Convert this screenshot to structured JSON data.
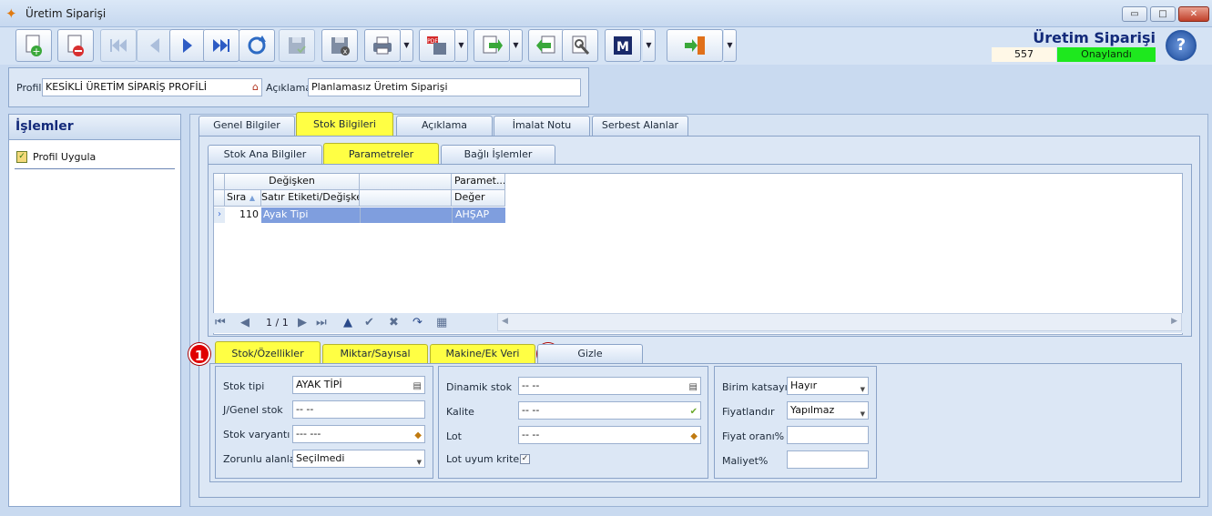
{
  "window": {
    "title": "Üretim Siparişi",
    "controls": {
      "minimize": "▭",
      "maximize": "□",
      "close": "✕"
    }
  },
  "toolbar": {
    "buttons": [
      "new-document-icon",
      "delete-document-icon",
      "first-record-icon",
      "previous-record-icon",
      "next-record-icon",
      "last-record-icon",
      "refresh-icon",
      "save-icon",
      "cancel-save-icon",
      "print-icon",
      "pdf-export-icon",
      "export-icon",
      "import-icon",
      "settings-icon",
      "m-logo-icon",
      "exit-icon"
    ]
  },
  "header": {
    "form_title": "Üretim Siparişi",
    "doc_number": "557",
    "status": "Onaylandı",
    "status_color": "#1ee81e",
    "help": "?"
  },
  "profile": {
    "profil_label": "Profil",
    "profil_value": "KESİKLİ ÜRETİM SİPARİŞ PROFİLİ",
    "aciklama_label": "Açıklama",
    "aciklama_value": "Planlamasız Üretim Siparişi"
  },
  "islemler": {
    "title": "İşlemler",
    "items": [
      "Profil Uygula"
    ]
  },
  "main_tabs": [
    "Genel Bilgiler",
    "Stok Bilgileri",
    "Açıklama",
    "İmalat Notu",
    "Serbest Alanlar"
  ],
  "sub_tabs": [
    "Stok Ana Bilgiler",
    "Parametreler",
    "Bağlı İşlemler"
  ],
  "grid": {
    "group_headers": [
      "Değişken",
      "",
      "Paramet..."
    ],
    "columns": [
      "Sıra",
      "Satır Etiketi/Değişken",
      "Değer"
    ],
    "rows": [
      {
        "sira": "110",
        "etiket": "Ayak Tipi",
        "deger": "AHŞAP"
      }
    ],
    "navigator": {
      "page": "1 / 1"
    }
  },
  "bottom_tabs": [
    "Stok/Özellikler",
    "Miktar/Sayısal",
    "Makine/Ek Veri",
    "Gizle"
  ],
  "badges": [
    "1",
    "2"
  ],
  "stok_group": {
    "fields": [
      {
        "label": "Stok tipi",
        "value": "AYAK TİPİ"
      },
      {
        "label": "J/Genel stok",
        "value": "-- --"
      },
      {
        "label": "Stok varyantı",
        "value": "--- ---"
      },
      {
        "label": "Zorunlu alanlar",
        "value": "Seçilmedi"
      }
    ]
  },
  "dinamik_group": {
    "fields": [
      {
        "label": "Dinamik stok",
        "value": "-- --"
      },
      {
        "label": "Kalite",
        "value": "-- --"
      },
      {
        "label": "Lot",
        "value": "-- --"
      }
    ],
    "checkbox_label": "Lot uyum kriteri",
    "checkbox_mark": "✓"
  },
  "birim_group": {
    "fields": [
      {
        "label": "Birim katsayısı",
        "value": "Hayır"
      },
      {
        "label": "Fiyatlandır",
        "value": "Yapılmaz"
      },
      {
        "label": "Fiyat oranı%",
        "value": ""
      },
      {
        "label": "Maliyet%",
        "value": ""
      }
    ]
  }
}
